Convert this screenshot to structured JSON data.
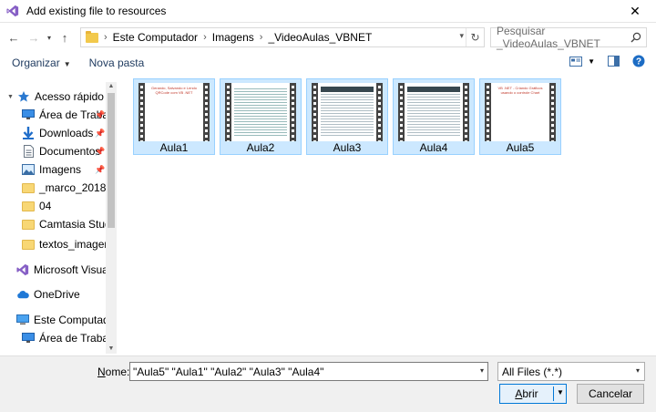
{
  "window": {
    "title": "Add existing file to resources",
    "close_glyph": "✕"
  },
  "address": {
    "crumbs": [
      "Este Computador",
      "Imagens",
      "_VideoAulas_VBNET"
    ],
    "search_placeholder": "Pesquisar _VideoAulas_VBNET"
  },
  "toolbar": {
    "organize_label": "Organizar",
    "new_folder_label": "Nova pasta"
  },
  "nav": {
    "items": [
      {
        "label": "Acesso rápido",
        "icon": "star-icon"
      },
      {
        "label": "Área de Traba",
        "icon": "desktop-icon",
        "pinned": true
      },
      {
        "label": "Downloads",
        "icon": "download-icon",
        "pinned": true
      },
      {
        "label": "Documentos",
        "icon": "document-icon",
        "pinned": true
      },
      {
        "label": "Imagens",
        "icon": "image-icon",
        "pinned": true
      },
      {
        "label": "_marco_2018",
        "icon": "folder-icon"
      },
      {
        "label": "04",
        "icon": "folder-icon"
      },
      {
        "label": "Camtasia Studio",
        "icon": "folder-icon"
      },
      {
        "label": "textos_imagens",
        "icon": "folder-icon"
      },
      {
        "label": "Microsoft Visual S",
        "icon": "visual-studio-icon"
      },
      {
        "label": "OneDrive",
        "icon": "cloud-icon"
      },
      {
        "label": "Este Computador",
        "icon": "computer-icon"
      },
      {
        "label": "Área de Trabalho",
        "icon": "desktop-icon"
      }
    ]
  },
  "files": [
    {
      "label": "Aula1",
      "thumb_text": "Gerando, Salvando e Lendo QRCode com VB .NET"
    },
    {
      "label": "Aula2",
      "thumb_text": ""
    },
    {
      "label": "Aula3",
      "thumb_text": ""
    },
    {
      "label": "Aula4",
      "thumb_text": ""
    },
    {
      "label": "Aula5",
      "thumb_text": "VB .NET - Criando Gráficos usando o controle Chart"
    }
  ],
  "bottom": {
    "name_label_u": "N",
    "name_label_rest": "ome:",
    "name_value": "\"Aula5\" \"Aula1\" \"Aula2\" \"Aula3\" \"Aula4\"",
    "filter_value": "All Files (*.*)",
    "open_label_u": "A",
    "open_label_rest": "brir",
    "cancel_label": "Cancelar"
  },
  "colors": {
    "selection_bg": "#cce8ff",
    "selection_border": "#99d1ff",
    "accent": "#0078d7"
  }
}
